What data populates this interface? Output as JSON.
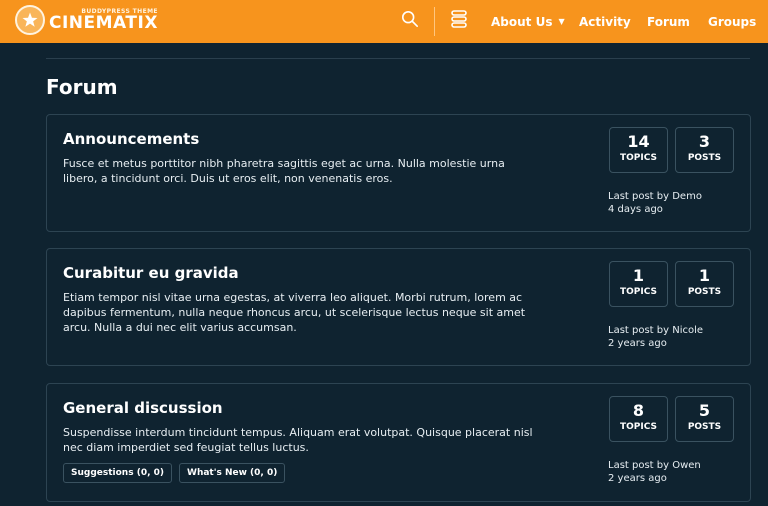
{
  "header": {
    "logo_small": "BUDDYPRESS THEME",
    "logo_big": "CINEMATIX",
    "nav": [
      {
        "label": "About Us"
      },
      {
        "label": "Activity"
      },
      {
        "label": "Forum"
      },
      {
        "label": "Groups"
      }
    ],
    "accent_color": "#f7941d"
  },
  "page": {
    "title": "Forum"
  },
  "forums": [
    {
      "title": "Announcements",
      "description": "Fusce et metus porttitor nibh pharetra sagittis eget ac urna. Nulla molestie urna libero, a tincidunt orci. Duis ut eros elit, non venenatis eros.",
      "topics": "14",
      "topics_label": "TOPICS",
      "posts": "3",
      "posts_label": "POSTS",
      "last_post": "Last post by Demo",
      "ago": "4 days ago"
    },
    {
      "title": "Curabitur eu gravida",
      "description": "Etiam tempor nisl vitae urna egestas, at viverra leo aliquet. Morbi rutrum, lorem ac dapibus fermentum, nulla neque rhoncus arcu, ut scelerisque lectus neque sit amet arcu. Nulla a dui nec elit varius accumsan.",
      "topics": "1",
      "topics_label": "TOPICS",
      "posts": "1",
      "posts_label": "POSTS",
      "last_post": "Last post by Nicole",
      "ago": "2 years ago"
    },
    {
      "title": "General discussion",
      "description": "Suspendisse interdum tincidunt tempus. Aliquam erat volutpat. Quisque placerat nisl nec diam imperdiet sed feugiat tellus luctus.",
      "topics": "8",
      "topics_label": "TOPICS",
      "posts": "5",
      "posts_label": "POSTS",
      "last_post": "Last post by Owen",
      "ago": "2 years ago",
      "subforums": [
        {
          "label": "Suggestions (0, 0)"
        },
        {
          "label": "What's New (0, 0)"
        }
      ]
    }
  ]
}
